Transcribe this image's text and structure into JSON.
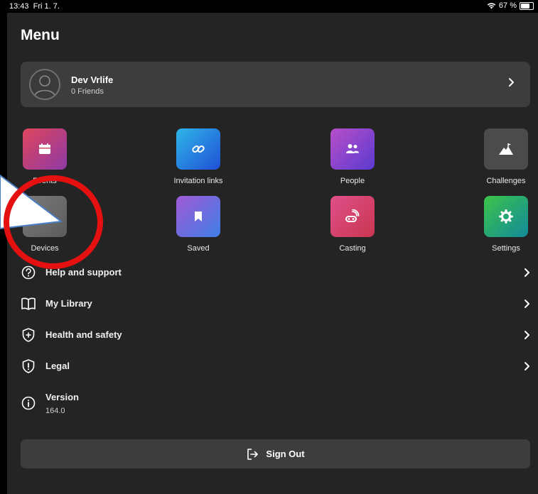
{
  "status": {
    "time": "13:43",
    "date": "Fri 1. 7.",
    "battery": "67 %",
    "battery_level": 0.67
  },
  "header": {
    "title": "Menu"
  },
  "profile": {
    "name": "Dev Vrlife",
    "friends": "0 Friends"
  },
  "grid": {
    "items": [
      {
        "label": "Events",
        "icon": "calendar-icon",
        "color_from": "#e0455c",
        "color_to": "#8e3aa6"
      },
      {
        "label": "Invitation links",
        "icon": "link-icon",
        "color_from": "#2fb6e8",
        "color_to": "#1f4fd6"
      },
      {
        "label": "People",
        "icon": "people-icon",
        "color_from": "#b84fc9",
        "color_to": "#5a3ad0"
      },
      {
        "label": "Challenges",
        "icon": "mountain-icon",
        "color_from": "#4b4b4b",
        "color_to": "#4b4b4b"
      },
      {
        "label": "Devices",
        "icon": "device-icon",
        "color_from": "#7a7a7a",
        "color_to": "#5c5c5c"
      },
      {
        "label": "Saved",
        "icon": "bookmark-icon",
        "color_from": "#a05ad6",
        "color_to": "#3f7fe6"
      },
      {
        "label": "Casting",
        "icon": "casting-icon",
        "color_from": "#e0508a",
        "color_to": "#c93650"
      },
      {
        "label": "Settings",
        "icon": "gear-icon",
        "color_from": "#3dc44a",
        "color_to": "#128a9a"
      }
    ]
  },
  "list": {
    "items": [
      {
        "label": "Help and support",
        "icon": "help-icon"
      },
      {
        "label": "My Library",
        "icon": "book-icon"
      },
      {
        "label": "Health and safety",
        "icon": "shield-plus-icon"
      },
      {
        "label": "Legal",
        "icon": "shield-alert-icon"
      }
    ],
    "version": {
      "label": "Version",
      "value": "164.0",
      "icon": "info-icon"
    }
  },
  "signout": {
    "label": "Sign Out",
    "icon": "sign-out-icon"
  },
  "colors": {
    "screen_bg": "#242424",
    "card_bg": "#3d3d3d",
    "callout_red": "#e51010",
    "callout_blue": "#4a7fc4"
  }
}
